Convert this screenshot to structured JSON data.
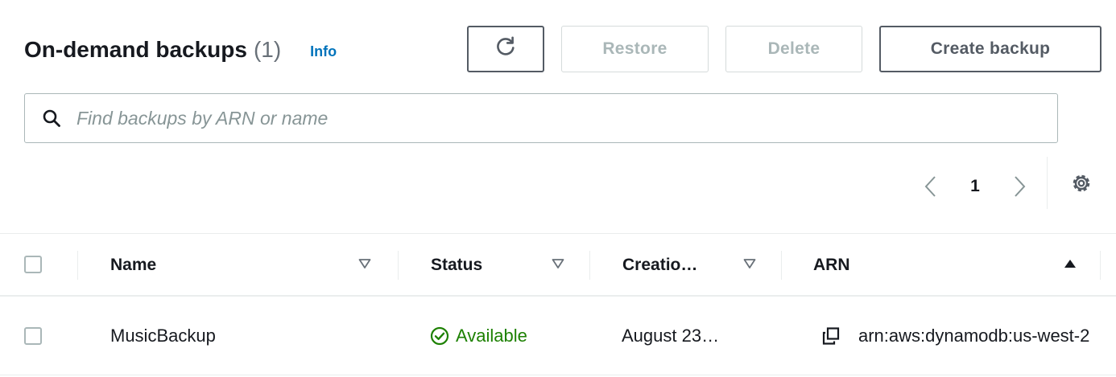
{
  "header": {
    "title": "On-demand backups",
    "count": "(1)",
    "info_label": "Info"
  },
  "toolbar": {
    "refresh_icon": "refresh-icon",
    "restore_label": "Restore",
    "delete_label": "Delete",
    "create_label": "Create backup"
  },
  "search": {
    "placeholder": "Find backups by ARN or name",
    "value": "",
    "icon": "search-icon"
  },
  "pagination": {
    "current_page": "1",
    "prev_icon": "chevron-left-icon",
    "next_icon": "chevron-right-icon",
    "settings_icon": "gear-icon"
  },
  "table": {
    "columns": [
      {
        "label": "Name",
        "sort": "sortable"
      },
      {
        "label": "Status",
        "sort": "sortable"
      },
      {
        "label": "Creatio…",
        "sort": "sortable"
      },
      {
        "label": "ARN",
        "sort": "ascending"
      }
    ],
    "rows": [
      {
        "name": "MusicBackup",
        "status": "Available",
        "creation": "August 23…",
        "arn": "arn:aws:dynamodb:us-west-2"
      }
    ]
  },
  "colors": {
    "accent_link": "#0073bb",
    "status_success": "#1d8102",
    "border": "#aab7b8",
    "disabled_text": "#aab7b8"
  }
}
